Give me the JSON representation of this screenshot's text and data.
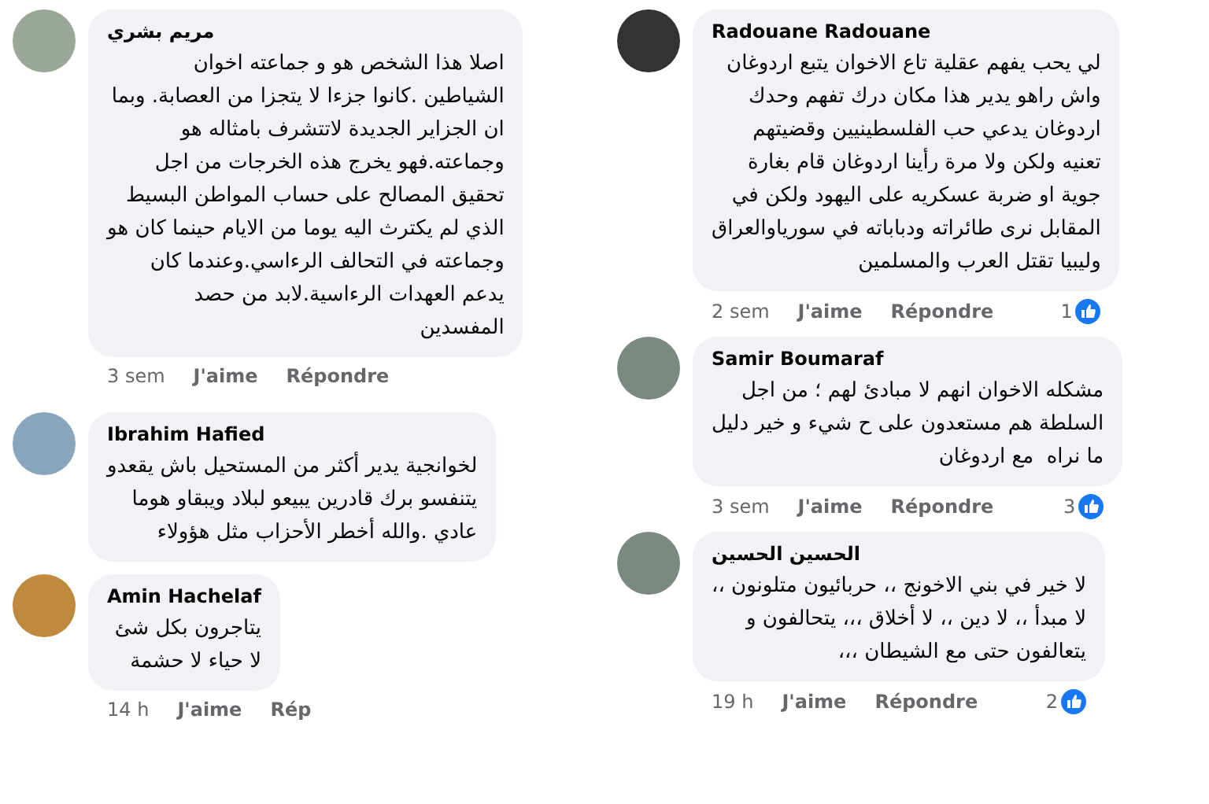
{
  "left_column": {
    "comments": [
      {
        "author": "مريم بشري",
        "text": "اصلا هذا الشخص هو و جماعته اخوان\nالشياطين .كانوا جزءا لا يتجزا من العصابة. وبما\nان الجزاير الجديدة لاتتشرف بامثاله هو\nوجماعته.فهو يخرج هذه الخرجات من اجل\nتحقيق المصالح على حساب المواطن البسيط\nالذي لم يكترث اليه يوما من الايام حينما كان هو\nوجماعته في التحالف الرءاسي.وعندما كان\nيدعم العهدات الرءاسية.لابد من حصد\nالمفسدين",
        "time": "3 sem",
        "like": "J'aime",
        "reply": "Répondre"
      },
      {
        "author": "Ibrahim Hafied",
        "text": "لخوانجية يدير أكثر من المستحيل باش يقعدو\nيتنفسو برك قادرين يبيعو لبلاد ويبقاو هوما\nعادي .والله أخطر الأحزاب مثل هؤولاء"
      },
      {
        "author": "Amin Hachelaf",
        "text": "يتاجرون بكل شئ\nلا حياء لا حشمة",
        "time": "14 h",
        "like": "J'aime",
        "reply": "Rép"
      }
    ]
  },
  "right_column": {
    "comments": [
      {
        "author": "Radouane Radouane",
        "text": "لي يحب يفهم عقلية تاع الاخوان يتبع اردوغان\nواش راهو يدير هذا مكان درك تفهم وحدك\nاردوغان يدعي حب الفلسطينيين وقضيتهم\nتعنيه ولكن ولا مرة رأينا اردوغان قام بغارة\nجوية او ضربة عسكريه على اليهود ولكن في\nالمقابل نرى طائراته ودباباته في سورياوالعراق\nوليبيا تقتل العرب والمسلمين",
        "time": "2 sem",
        "like": "J'aime",
        "reply": "Répondre",
        "reactions": "1"
      },
      {
        "author": "Samir Boumaraf",
        "text": "مشكله الاخوان انهم لا مبادئ لهم ؛ من اجل\nالسلطة هم مستعدون على ح شيء و خير دليل\nما نراه  مع اردوغان",
        "time": "3 sem",
        "like": "J'aime",
        "reply": "Répondre",
        "reactions": "3"
      },
      {
        "author": "الحسين الحسين",
        "text": "لا خير في بني الاخونج ،، حربائيون متلونون ،،\nلا مبدأ ،، لا دين ،، لا أخلاق ،،، يتحالفون و\nيتعالفون حتى مع الشيطان ،،،",
        "time": "19 h",
        "like": "J'aime",
        "reply": "Répondre",
        "reactions": "2"
      }
    ]
  }
}
